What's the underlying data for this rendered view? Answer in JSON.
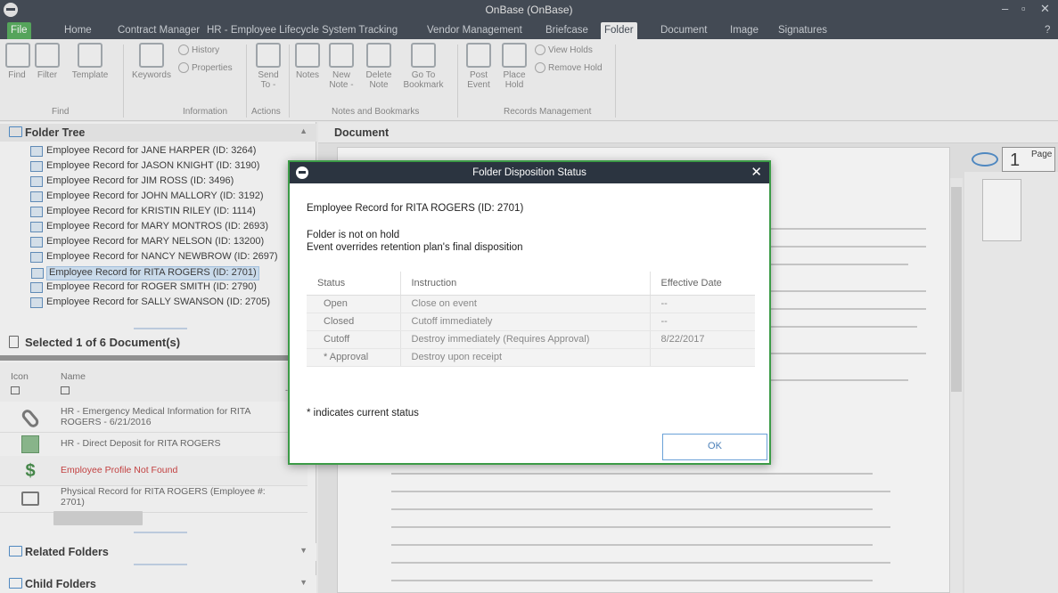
{
  "window": {
    "title": "OnBase (OnBase)"
  },
  "tabs": [
    "File",
    "Home",
    "Contract Manager",
    "HR - Employee Lifecycle System Tracking",
    "Vendor Management",
    "Briefcase",
    "Folder",
    "Document",
    "Image",
    "Signatures"
  ],
  "ribbon": {
    "find": "Find",
    "filter": "Filter",
    "template": "Template",
    "keywords": "Keywords",
    "history": "History",
    "properties": "Properties",
    "send_to": "Send To -",
    "notes": "Notes",
    "new_note": "New Note -",
    "delete_note": "Delete Note",
    "go_to_bookmark": "Go To Bookmark",
    "post_event": "Post Event",
    "place_hold": "Place Hold",
    "view_holds": "View Holds",
    "remove_hold": "Remove Hold",
    "group_find": "Find",
    "group_information": "Information",
    "group_actions": "Actions",
    "group_notes": "Notes and Bookmarks",
    "group_records": "Records Management"
  },
  "folder_tree": {
    "title": "Folder Tree",
    "items": [
      "Employee Record for JANE HARPER (ID: 3264)",
      "Employee Record for JASON KNIGHT (ID: 3190)",
      "Employee Record for JIM ROSS (ID: 3496)",
      "Employee Record for JOHN MALLORY (ID: 3192)",
      "Employee Record for KRISTIN RILEY (ID: 1114)",
      "Employee Record for MARY MONTROS (ID: 2693)",
      "Employee Record for MARY NELSON (ID: 13200)",
      "Employee Record for NANCY NEWBROW (ID: 2697)",
      "Employee Record for RITA ROGERS (ID: 2701)",
      "Employee Record for ROGER SMITH (ID: 2790)",
      "Employee Record for SALLY SWANSON (ID: 2705)"
    ]
  },
  "documents": {
    "title": "Selected 1 of 6 Document(s)",
    "col_icon": "Icon",
    "col_name": "Name",
    "rows": [
      "HR - Emergency Medical Information for RITA ROGERS - 6/21/2016",
      "HR - Direct Deposit for RITA ROGERS",
      "Employee Profile Not Found",
      "Physical Record for RITA ROGERS (Employee #: 2701)"
    ]
  },
  "related_folders": "Related Folders",
  "child_folders": "Child Folders",
  "viewer": {
    "header": "Document",
    "page_number": "1",
    "page_label": "Page"
  },
  "dialog": {
    "title": "Folder Disposition Status",
    "record": "Employee Record for RITA ROGERS (ID: 2701)",
    "hold_status": "Folder is not on hold",
    "event_note": "Event overrides retention plan's final disposition",
    "headers": [
      "Status",
      "Instruction",
      "Effective Date"
    ],
    "rows": [
      {
        "status": "Open",
        "instruction": "Close on event",
        "date": "--"
      },
      {
        "status": "Closed",
        "instruction": "Cutoff immediately",
        "date": "--"
      },
      {
        "status": "Cutoff",
        "instruction": "Destroy immediately (Requires Approval)",
        "date": "8/22/2017"
      },
      {
        "status": "* Approval",
        "instruction": "Destroy upon receipt",
        "date": ""
      }
    ],
    "footnote": "* indicates current status",
    "ok": "OK"
  }
}
